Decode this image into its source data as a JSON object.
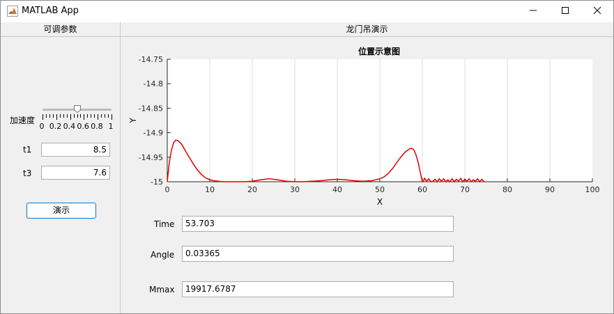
{
  "window": {
    "title": "MATLAB App"
  },
  "left_panel": {
    "header": "可调参数",
    "slider": {
      "label": "加速度",
      "value": 0.5,
      "tick_labels": [
        "0",
        "0.2",
        "0.4",
        "0.6",
        "0.8",
        "1"
      ]
    },
    "t1": {
      "label": "t1",
      "value": "8.5"
    },
    "t3": {
      "label": "t3",
      "value": "7.6"
    },
    "demo_button": "演示"
  },
  "right_panel": {
    "header": "龙门吊演示",
    "fields": {
      "time": {
        "label": "Time",
        "value": "53.703"
      },
      "angle": {
        "label": "Angle",
        "value": "0.03365"
      },
      "mmax": {
        "label": "Mmax",
        "value": "19917.6787"
      }
    }
  },
  "chart_data": {
    "type": "line",
    "title": "位置示意图",
    "xlabel": "X",
    "ylabel": "Y",
    "xlim": [
      0,
      100
    ],
    "ylim": [
      -15,
      -14.75
    ],
    "xticks": [
      0,
      10,
      20,
      30,
      40,
      50,
      60,
      70,
      80,
      90,
      100
    ],
    "yticks": [
      -14.75,
      -14.8,
      -14.85,
      -14.9,
      -14.95,
      -15
    ],
    "ytick_labels": [
      "-14.75",
      "-14.8",
      "-14.85",
      "-14.9",
      "-14.95",
      "-15"
    ],
    "grid": "x",
    "line_color": "#e00000",
    "series": [
      {
        "x": [
          0,
          0.5,
          1,
          1.5,
          2,
          2.5,
          3,
          3.5,
          4,
          5,
          6,
          7,
          8,
          9,
          10,
          11,
          12,
          13,
          14,
          15,
          16,
          18,
          20,
          22,
          24,
          26,
          28,
          30,
          32,
          34,
          36,
          38,
          40,
          42,
          44,
          46,
          48,
          50,
          51,
          52,
          53,
          54,
          55,
          56,
          57,
          57.5,
          58,
          58.5,
          59,
          59.5,
          60,
          60.2
        ],
        "y": [
          -15,
          -14.96,
          -14.935,
          -14.92,
          -14.915,
          -14.916,
          -14.92,
          -14.925,
          -14.933,
          -14.948,
          -14.962,
          -14.975,
          -14.985,
          -14.992,
          -14.996,
          -14.998,
          -14.999,
          -15,
          -15,
          -15,
          -15,
          -15,
          -14.999,
          -14.996,
          -14.994,
          -14.996,
          -14.999,
          -15,
          -15,
          -14.999,
          -14.998,
          -14.996,
          -14.995,
          -14.996,
          -14.998,
          -14.999,
          -14.998,
          -14.994,
          -14.99,
          -14.983,
          -14.973,
          -14.961,
          -14.949,
          -14.939,
          -14.933,
          -14.932,
          -14.935,
          -14.945,
          -14.96,
          -14.98,
          -15,
          -15
        ]
      },
      {
        "x": [
          60.2,
          60.5,
          61,
          61.5,
          62,
          62.5,
          63,
          63.5,
          64,
          64.5,
          65,
          65.5,
          66,
          66.5,
          67,
          67.5,
          68,
          68.5,
          69,
          69.5,
          70,
          70.5,
          71,
          71.5,
          72,
          72.5,
          73,
          73.5,
          74,
          74.5
        ],
        "y": [
          -15,
          -14.993,
          -14.999,
          -14.994,
          -15,
          -14.999,
          -14.995,
          -15,
          -14.994,
          -14.999,
          -14.994,
          -15,
          -14.996,
          -15,
          -14.994,
          -15,
          -14.995,
          -14.999,
          -14.993,
          -15,
          -14.995,
          -14.999,
          -14.994,
          -15,
          -14.996,
          -14.999,
          -14.994,
          -15,
          -14.995,
          -15
        ]
      }
    ]
  }
}
